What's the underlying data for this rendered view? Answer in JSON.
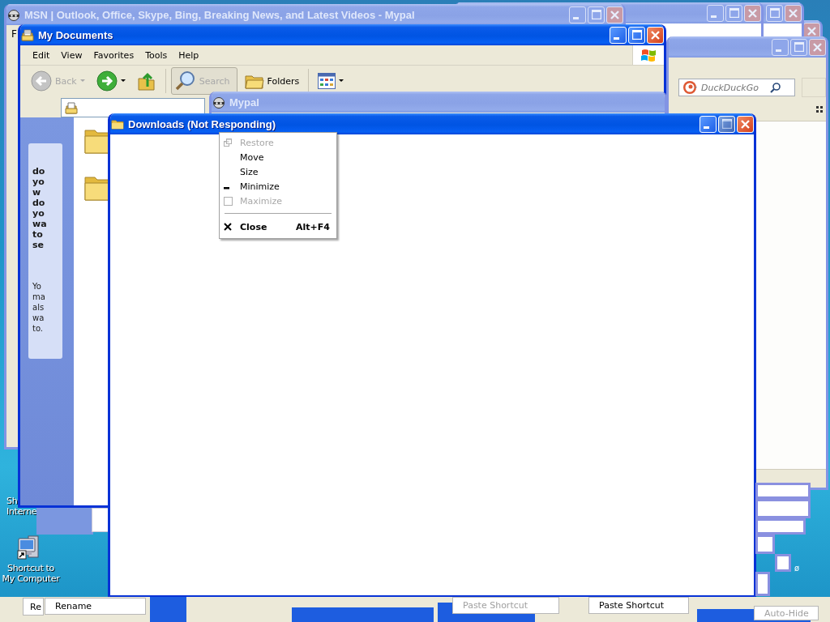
{
  "desktop_icons": [
    {
      "label": "Sh Interne"
    },
    {
      "label": "Shortcut to My Computer"
    }
  ],
  "background_windows": [
    {
      "active": false,
      "buttons": [
        {
          "kind": "close",
          "disabled": false
        }
      ]
    },
    {
      "active": false,
      "buttons": [
        {
          "kind": "maximize",
          "disabled": false
        },
        {
          "kind": "close",
          "disabled": false
        }
      ]
    },
    {
      "active": false,
      "buttons": [
        {
          "kind": "minimize",
          "disabled": false
        },
        {
          "kind": "maximize",
          "disabled": false
        },
        {
          "kind": "close",
          "disabled": false
        }
      ]
    }
  ],
  "msn_window": {
    "title": "MSN | Outlook, Office, Skype, Bing, Breaking News, and Latest Videos - Mypal",
    "active": false,
    "menu": [
      "F"
    ],
    "buttons": [
      {
        "kind": "minimize",
        "disabled": false
      },
      {
        "kind": "maximize",
        "disabled": false
      },
      {
        "kind": "close",
        "disabled": false
      }
    ]
  },
  "search_window": {
    "active": false,
    "search": {
      "placeholder": "DuckDuckGo"
    },
    "buttons": [
      {
        "kind": "minimize",
        "disabled": false
      },
      {
        "kind": "maximize",
        "disabled": false
      },
      {
        "kind": "close",
        "disabled": false
      }
    ]
  },
  "my_documents_window": {
    "title": "My Documents",
    "active": true,
    "menu": [
      "Edit",
      "View",
      "Favorites",
      "Tools",
      "Help"
    ],
    "toolbar": [
      {
        "kind": "back",
        "label": "Back",
        "disabled": true
      },
      {
        "kind": "forward"
      },
      {
        "kind": "up"
      },
      {
        "kind": "search",
        "label": "Search",
        "disabled": true
      },
      {
        "kind": "folders",
        "label": "Folders"
      },
      {
        "kind": "views"
      }
    ],
    "task_pane": {
      "heading_lines": [
        "do",
        "yo",
        "w",
        "do",
        "yo",
        "wa",
        "to",
        "se"
      ],
      "body_lines": [
        "Yo",
        "ma",
        "als",
        "wa",
        "to."
      ]
    },
    "buttons": [
      {
        "kind": "minimize",
        "disabled": false
      },
      {
        "kind": "maximize",
        "disabled": false
      },
      {
        "kind": "close",
        "disabled": false
      }
    ]
  },
  "mypal_window": {
    "title": "Mypal",
    "active": false
  },
  "downloads_window": {
    "title": "Downloads (Not Responding)",
    "active": true,
    "buttons": [
      {
        "kind": "minimize",
        "disabled": false
      },
      {
        "kind": "maximize",
        "disabled": true
      },
      {
        "kind": "close",
        "disabled": false
      }
    ]
  },
  "system_menu": {
    "items": [
      {
        "kind": "restore",
        "label": "Restore",
        "disabled": true
      },
      {
        "kind": "plain",
        "label": "Move",
        "disabled": false
      },
      {
        "kind": "plain",
        "label": "Size",
        "disabled": false
      },
      {
        "kind": "minimize",
        "label": "Minimize",
        "disabled": false
      },
      {
        "kind": "maximize",
        "label": "Maximize",
        "disabled": true
      },
      {
        "kind": "separator"
      },
      {
        "kind": "close",
        "label": "Close",
        "shortcut": "Alt+F4",
        "disabled": false
      }
    ]
  },
  "stray_mark": "ø",
  "taskbar_fragments": [
    {
      "text": "Re",
      "faded": false
    },
    {
      "text": "Rename",
      "faded": false
    },
    {
      "text": "Paste Shortcut",
      "faded": true
    },
    {
      "text": "Paste Shortcut",
      "faded": false
    },
    {
      "text": "Auto-Hide",
      "faded": true
    }
  ]
}
